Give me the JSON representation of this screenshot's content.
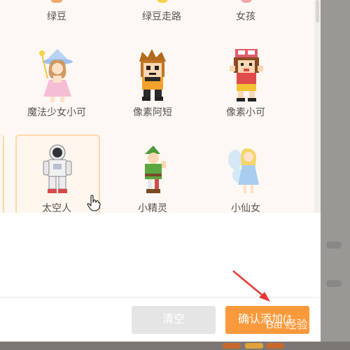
{
  "characters": {
    "row1": [
      "绿豆",
      "绿豆走路",
      "女孩"
    ],
    "row2": [
      "魔法少女小可",
      "像素阿短",
      "像素小可"
    ],
    "row3": [
      "太空人",
      "小精灵",
      "小仙女"
    ]
  },
  "footer": {
    "clear_label": "清空",
    "confirm_label": "确认添加(1"
  },
  "watermark": {
    "text": "Bai 经验"
  },
  "colors": {
    "accent": "#fb9a3c",
    "selected_border": "#fbd9a8",
    "grid_bg": "#fdf8f3"
  },
  "selected_character": "太空人"
}
